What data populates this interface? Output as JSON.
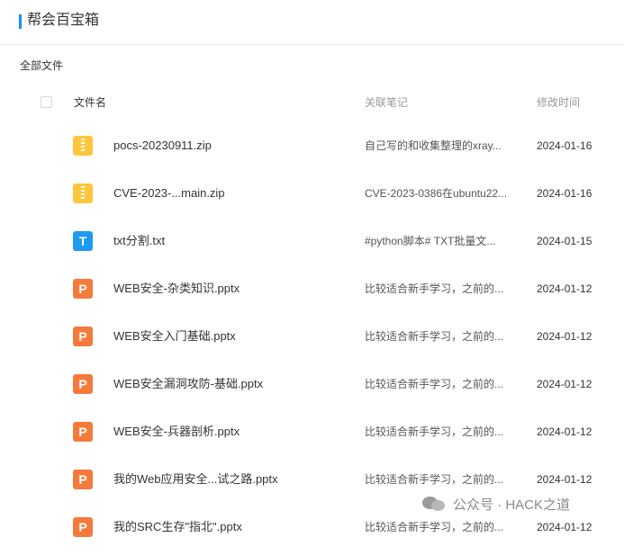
{
  "header": {
    "title": "帮会百宝箱"
  },
  "breadcrumb": "全部文件",
  "columns": {
    "name": "文件名",
    "note": "关联笔记",
    "date": "修改时间"
  },
  "files": [
    {
      "name": "pocs-20230911.zip",
      "note": "自己写的和收集整理的xray...",
      "date": "2024-01-16",
      "icon": "zip-file-icon"
    },
    {
      "name": "CVE-2023-...main.zip",
      "note": "CVE-2023-0386在ubuntu22...",
      "date": "2024-01-16",
      "icon": "zip-file-icon"
    },
    {
      "name": "txt分割.txt",
      "note": "#python脚本# TXT批量文...",
      "date": "2024-01-15",
      "icon": "txt-file-icon"
    },
    {
      "name": "WEB安全-杂类知识.pptx",
      "note": "比较适合新手学习，之前的...",
      "date": "2024-01-12",
      "icon": "ppt-file-icon"
    },
    {
      "name": "WEB安全入门基础.pptx",
      "note": "比较适合新手学习，之前的...",
      "date": "2024-01-12",
      "icon": "ppt-file-icon"
    },
    {
      "name": "WEB安全漏洞攻防-基础.pptx",
      "note": "比较适合新手学习，之前的...",
      "date": "2024-01-12",
      "icon": "ppt-file-icon"
    },
    {
      "name": "WEB安全-兵器剖析.pptx",
      "note": "比较适合新手学习，之前的...",
      "date": "2024-01-12",
      "icon": "ppt-file-icon"
    },
    {
      "name": "我的Web应用安全...试之路.pptx",
      "note": "比较适合新手学习，之前的...",
      "date": "2024-01-12",
      "icon": "ppt-file-icon"
    },
    {
      "name": "我的SRC生存\"指北\".pptx",
      "note": "比较适合新手学习，之前的...",
      "date": "2024-01-12",
      "icon": "ppt-file-icon"
    }
  ],
  "icon_glyphs": {
    "txt": "T",
    "ppt": "P"
  },
  "watermark": "公众号 · HACK之道",
  "colors": {
    "accent": "#1a8cff",
    "zip": "#ffc53d",
    "txt": "#1e9bf0",
    "ppt": "#f47a3b"
  }
}
